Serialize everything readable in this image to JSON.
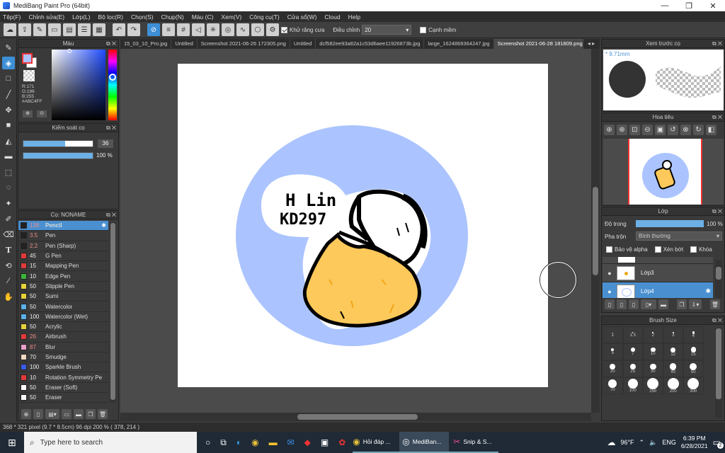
{
  "window": {
    "title": "MediBang Paint Pro (64bit)"
  },
  "menu": [
    "Tệp(F)",
    "Chỉnh sửa(E)",
    "Lớp(L)",
    "Bộ lọc(R)",
    "Chọn(S)",
    "Chụp(N)",
    "Màu (C)",
    "Xem(V)",
    "Công cụ(T)",
    "Cửa sổ(W)",
    "Cloud",
    "Help"
  ],
  "toolbar": {
    "antialias_label": "Khử răng cưa",
    "adjust_label": "Điều chỉnh",
    "adjust_value": "20",
    "soft_edge_label": "Cạnh mềm"
  },
  "tabs": [
    "15_03_10_Pro.jpg",
    "Untitled",
    "Screenshot 2021-06-26 172305.png",
    "Untitled",
    "dcf582ee93a82a1c53d6aee11926873b.jpg",
    "large_1624869364247.jpg",
    "Screenshot 2021-06-28 181809.png"
  ],
  "color_panel": {
    "title": "Màu",
    "r": "R:171",
    "g": "G:196",
    "b": "B:255",
    "hex": "#ABC4FF",
    "fg_color": "#ABC4FF"
  },
  "brush_control": {
    "title": "Kiểm soát cọ",
    "size": "36",
    "opacity": "100 %",
    "size_fill": 0.6,
    "opacity_fill": 1.0
  },
  "brush_panel": {
    "title": "Cọ: NONAME",
    "brushes": [
      {
        "size": "138",
        "name": "Pencil",
        "color": "#222222"
      },
      {
        "size": "3.5",
        "name": "Pen",
        "color": "#222222"
      },
      {
        "size": "2.2",
        "name": "Pen (Sharp)",
        "color": "#222222"
      },
      {
        "size": "45",
        "name": "G Pen",
        "color": "#e23a3a"
      },
      {
        "size": "15",
        "name": "Mapping Pen",
        "color": "#e23a3a"
      },
      {
        "size": "10",
        "name": "Edge Pen",
        "color": "#3ab53a"
      },
      {
        "size": "50",
        "name": "Stipple Pen",
        "color": "#e8d23a"
      },
      {
        "size": "50",
        "name": "Sumi",
        "color": "#e8d23a"
      },
      {
        "size": "50",
        "name": "Watercolor",
        "color": "#5ab0e8"
      },
      {
        "size": "100",
        "name": "Watercolor (Wet)",
        "color": "#5ab0e8"
      },
      {
        "size": "50",
        "name": "Acrylic",
        "color": "#e8d23a"
      },
      {
        "size": "26",
        "name": "Airbrush",
        "color": "#e23a3a"
      },
      {
        "size": "87",
        "name": "Blur",
        "color": "#e8a0c8"
      },
      {
        "size": "70",
        "name": "Smudge",
        "color": "#f0d8c0"
      },
      {
        "size": "100",
        "name": "Sparkle Brush",
        "color": "#3a5ae8"
      },
      {
        "size": "10",
        "name": "Rotation Symmetry Pe",
        "color": "#e23a3a"
      },
      {
        "size": "50",
        "name": "Eraser (Soft)",
        "color": "#ffffff"
      },
      {
        "size": "50",
        "name": "Eraser",
        "color": "#ffffff"
      }
    ]
  },
  "preview_panel": {
    "title": "Xem trước cọ",
    "size_text": "9.71mm"
  },
  "navigator_panel": {
    "title": "Hoa tiêu"
  },
  "layer_panel": {
    "title": "Lớp",
    "opacity_label": "Độ trong",
    "opacity_value": "100 %",
    "blend_label": "Pha trộn",
    "blend_value": "Bình thường",
    "protect_alpha": "Bảo vệ alpha",
    "clipping": "Xén bớt",
    "lock": "Khóa",
    "layers": [
      {
        "name": "Lớp3"
      },
      {
        "name": "Lớp4"
      }
    ]
  },
  "brush_size_panel": {
    "title": "Brush Size",
    "sizes": [
      "1",
      "1.5",
      "2",
      "3",
      "4",
      "5",
      "7",
      "10",
      "12",
      "15",
      "20",
      "25",
      "30",
      "40",
      "50",
      "70",
      "100",
      "150",
      "200",
      "300"
    ]
  },
  "canvas_text": {
    "line1": "H Lin",
    "line2": "KD297"
  },
  "status": {
    "text": "368 * 321 pixel  (9.7 * 8.5cm)  96 dpi  200 %  ( 378, 214 )"
  },
  "taskbar": {
    "search_placeholder": "Type here to search",
    "app1": "Hỏi đáp ...",
    "app2": "MediBan...",
    "app3": "Snip & S...",
    "weather": "96°F",
    "lang": "ENG",
    "time": "6:39 PM",
    "date": "6/28/2021",
    "notif_count": "2"
  }
}
